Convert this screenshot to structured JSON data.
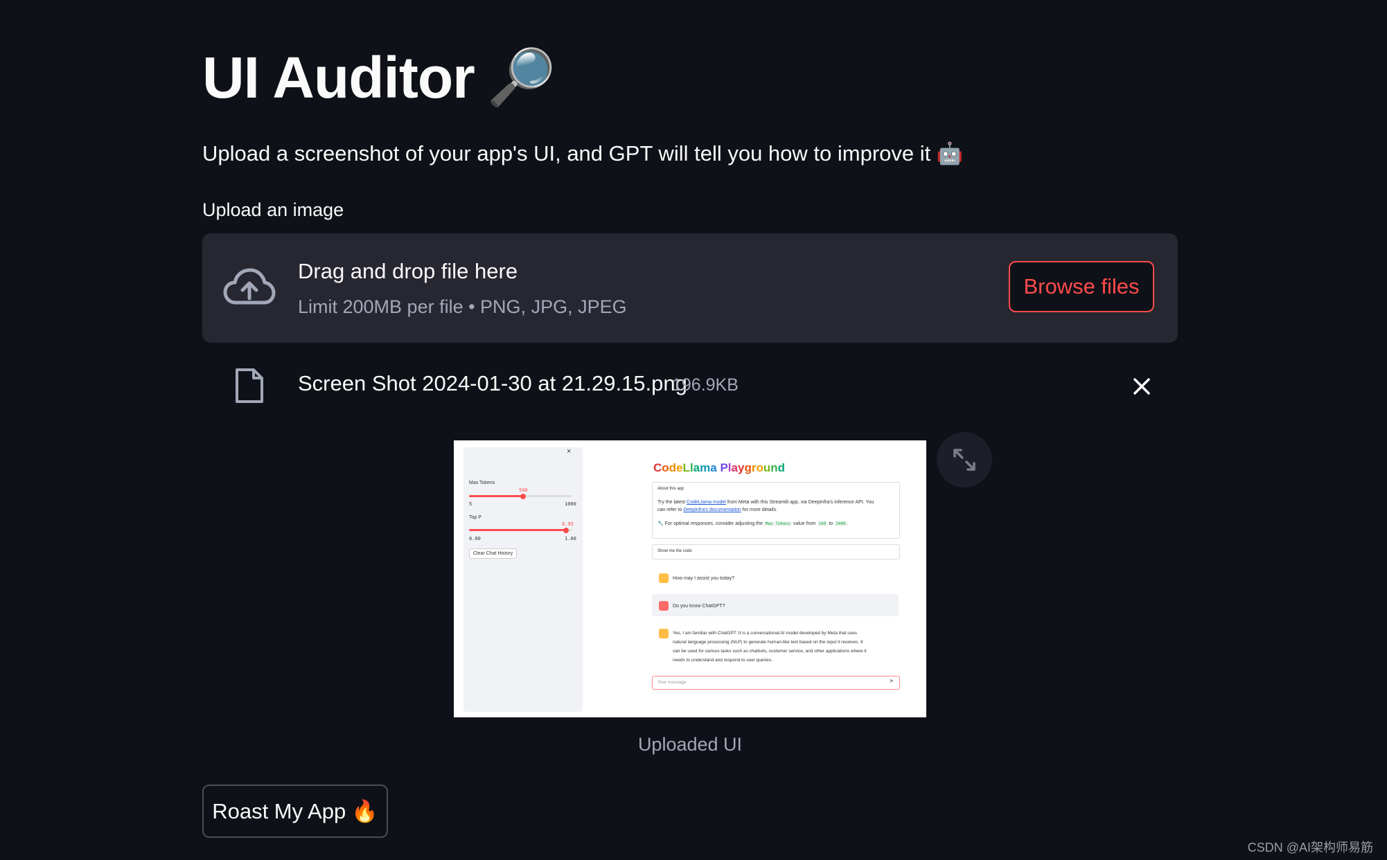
{
  "header": {
    "title": "UI Auditor",
    "title_emoji": "🔎",
    "subtitle": "Upload a screenshot of your app's UI, and GPT will tell you how to improve it 🤖"
  },
  "uploader": {
    "label": "Upload an image",
    "drop_text": "Drag and drop file here",
    "limit_text": "Limit 200MB per file • PNG, JPG, JPEG",
    "browse_label": "Browse files"
  },
  "file": {
    "name": "Screen Shot 2024-01-30 at 21.29.15.png",
    "size": "196.9KB"
  },
  "image_caption": "Uploaded UI",
  "action": {
    "label": "Roast My App",
    "emoji": "🔥"
  },
  "watermark": "CSDN @AI架构师易筋",
  "colors": {
    "background": "#0e1117",
    "accent": "#ff4b4b",
    "dropzone_bg": "#262730",
    "muted_text": "#a3a8b8"
  },
  "icons": {
    "upload": "cloud-upload-icon",
    "file": "file-icon",
    "remove": "close-icon",
    "expand": "fullscreen-icon"
  },
  "preview": {
    "close": "×",
    "max_tokens_label": "Max Tokens",
    "max_tokens_value": "500",
    "max_tokens_min": "5",
    "max_tokens_max": "1000",
    "top_p_label": "Top P",
    "top_p_value": "0.95",
    "top_p_min": "0.00",
    "top_p_max": "1.00",
    "clear_button": "Clear Chat History",
    "app_title_letters": [
      "C",
      "o",
      "d",
      "e",
      "L",
      "l",
      "a",
      "m",
      "a",
      " ",
      "P",
      "l",
      "a",
      "y",
      "g",
      "r",
      "o",
      "u",
      "n",
      "d"
    ],
    "about_header": "About this app",
    "about_line1_pre": "Try the latest ",
    "about_line1_link": "CodeLlama model",
    "about_line1_post": " from Meta with this Streamlit app, via DeepInfra's inference API. You",
    "about_line2_pre": "can refer to ",
    "about_line2_link": "DeepInfra's documentation",
    "about_line2_post": " for more details.",
    "tip_pre": "🔧 For optimal responses, consider adjusting the ",
    "tip_code1": "Max Tokens",
    "tip_mid": " value from ",
    "tip_code2": "100",
    "tip_to": " to ",
    "tip_code3": "1000",
    "tip_end": ".",
    "show_code": "Show me the code",
    "msg1": "How may I assist you today?",
    "msg2": "Do you know ChatGPT?",
    "msg3_l1": "Yes, I am familiar with ChatGPT. It is a conversational AI model developed by Meta that uses",
    "msg3_l2": "natural language processing (NLP) to generate human-like text based on the input it receives. It",
    "msg3_l3": "can be used for various tasks such as chatbots, customer service, and other applications where it",
    "msg3_l4": "needs to understand and respond to user queries.",
    "input_placeholder": "Your message"
  }
}
